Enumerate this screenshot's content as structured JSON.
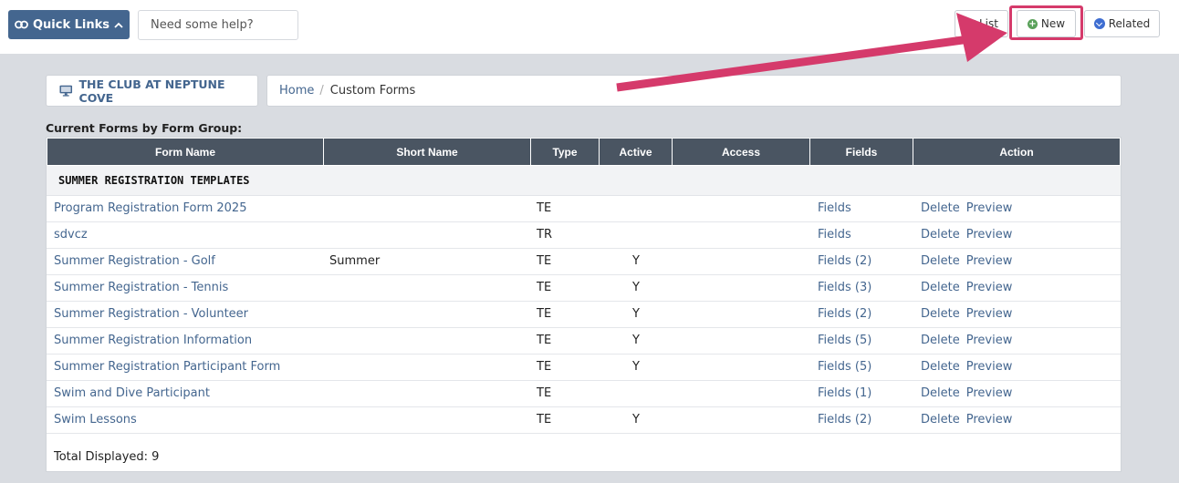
{
  "topbar": {
    "quick_links_label": "Quick Links",
    "help_placeholder": "Need some help?",
    "list_label": "List",
    "new_label": "New",
    "related_label": "Related"
  },
  "club": {
    "name": "THE CLUB AT NEPTUNE COVE"
  },
  "breadcrumb": {
    "home": "Home",
    "separator": "/",
    "current": "Custom Forms"
  },
  "section_title": "Current Forms by Form Group:",
  "table": {
    "headers": {
      "form_name": "Form Name",
      "short_name": "Short Name",
      "type": "Type",
      "active": "Active",
      "access": "Access",
      "fields": "Fields",
      "action": "Action"
    },
    "group": "SUMMER REGISTRATION TEMPLATES",
    "rows": [
      {
        "name": "Program Registration Form 2025",
        "short": "",
        "type": "TE",
        "active": "",
        "fields": "Fields",
        "delete": "Delete",
        "preview": "Preview"
      },
      {
        "name": "sdvcz",
        "short": "",
        "type": "TR",
        "active": "",
        "fields": "Fields",
        "delete": "Delete",
        "preview": "Preview"
      },
      {
        "name": "Summer Registration - Golf",
        "short": "Summer",
        "type": "TE",
        "active": "Y",
        "fields": "Fields (2)",
        "delete": "Delete",
        "preview": "Preview"
      },
      {
        "name": "Summer Registration - Tennis",
        "short": "",
        "type": "TE",
        "active": "Y",
        "fields": "Fields (3)",
        "delete": "Delete",
        "preview": "Preview"
      },
      {
        "name": "Summer Registration - Volunteer",
        "short": "",
        "type": "TE",
        "active": "Y",
        "fields": "Fields (2)",
        "delete": "Delete",
        "preview": "Preview"
      },
      {
        "name": "Summer Registration Information",
        "short": "",
        "type": "TE",
        "active": "Y",
        "fields": "Fields (5)",
        "delete": "Delete",
        "preview": "Preview"
      },
      {
        "name": "Summer Registration Participant Form",
        "short": "",
        "type": "TE",
        "active": "Y",
        "fields": "Fields (5)",
        "delete": "Delete",
        "preview": "Preview"
      },
      {
        "name": "Swim and Dive Participant",
        "short": "",
        "type": "TE",
        "active": "",
        "fields": "Fields (1)",
        "delete": "Delete",
        "preview": "Preview"
      },
      {
        "name": "Swim Lessons",
        "short": "",
        "type": "TE",
        "active": "Y",
        "fields": "Fields (2)",
        "delete": "Delete",
        "preview": "Preview"
      }
    ],
    "total": "Total Displayed: 9"
  },
  "colors": {
    "accent": "#44668f",
    "header": "#4a5562",
    "highlight": "#d53a6b"
  }
}
